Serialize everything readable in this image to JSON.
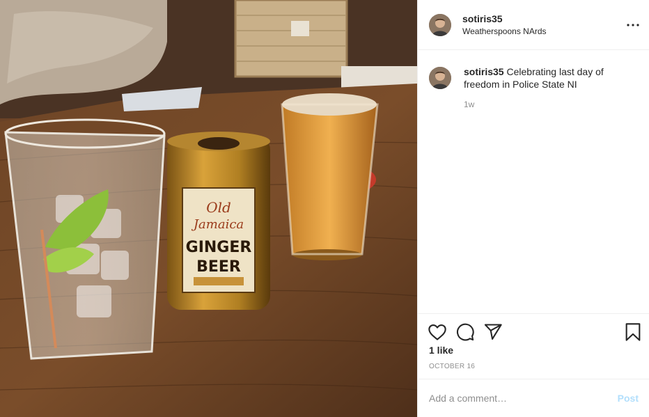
{
  "post": {
    "username": "sotiris35",
    "location": "Weatherspoons NArds",
    "caption": "Celebrating last day of freedom in Police State NI",
    "time_ago": "1w",
    "likes": "1 like",
    "date": "OCTOBER 16"
  },
  "photo": {
    "can_line1": "Old",
    "can_line2": "Jamaica",
    "can_line3": "GINGER",
    "can_line4": "BEER"
  },
  "comment": {
    "placeholder": "Add a comment…",
    "post_label": "Post"
  },
  "icons": {
    "more": "more-horizontal-icon",
    "like": "heart-icon",
    "comment": "comment-bubble-icon",
    "share": "paper-plane-icon",
    "save": "bookmark-icon"
  },
  "colors": {
    "link_disabled": "#b2dffc",
    "secondary_text": "#8e8e8e",
    "primary_text": "#262626"
  }
}
